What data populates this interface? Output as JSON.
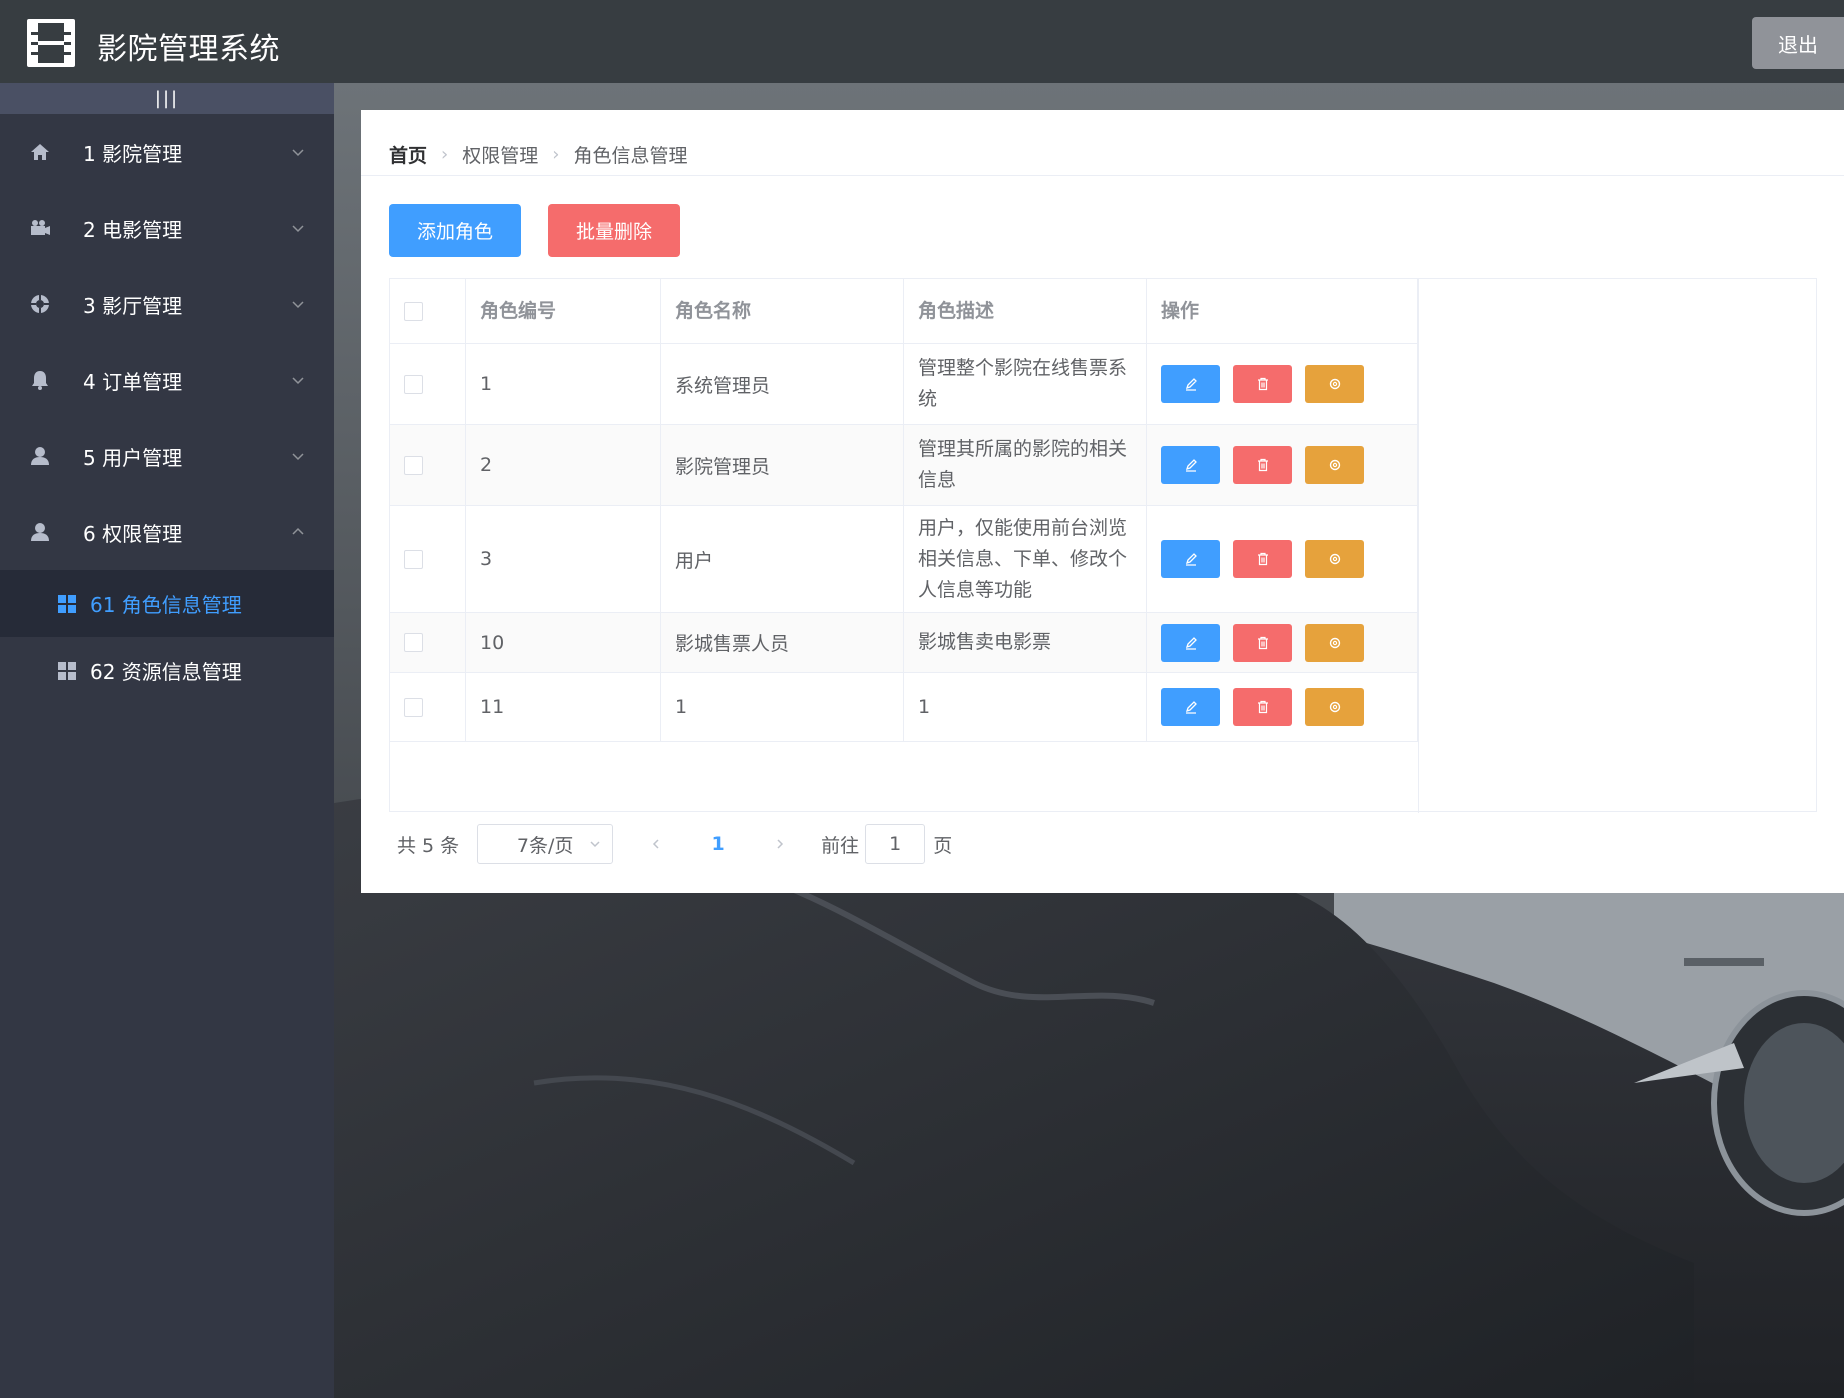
{
  "app": {
    "title": "影院管理系统",
    "logout_label": "退出"
  },
  "sidebar": {
    "collapse_label": "|||",
    "items": [
      {
        "label": "1 影院管理",
        "icon": "home-icon",
        "expanded": false
      },
      {
        "label": "2 电影管理",
        "icon": "camera-icon",
        "expanded": false
      },
      {
        "label": "3 影厅管理",
        "icon": "lifebuoy-icon",
        "expanded": false
      },
      {
        "label": "4 订单管理",
        "icon": "bell-icon",
        "expanded": false
      },
      {
        "label": "5 用户管理",
        "icon": "user-icon",
        "expanded": false
      },
      {
        "label": "6 权限管理",
        "icon": "user-icon",
        "expanded": true
      }
    ],
    "subitems": [
      {
        "label": "61 角色信息管理",
        "icon": "grid-icon",
        "active": true
      },
      {
        "label": "62 资源信息管理",
        "icon": "grid-icon",
        "active": false
      }
    ]
  },
  "breadcrumb": [
    "首页",
    "权限管理",
    "角色信息管理"
  ],
  "toolbar": {
    "add_label": "添加角色",
    "batch_delete_label": "批量删除"
  },
  "table": {
    "headers": [
      "角色编号",
      "角色名称",
      "角色描述",
      "操作"
    ],
    "rows": [
      {
        "id": "1",
        "name": "系统管理员",
        "desc": "管理整个影院在线售票系统"
      },
      {
        "id": "2",
        "name": "影院管理员",
        "desc": "管理其所属的影院的相关信息"
      },
      {
        "id": "3",
        "name": "用户",
        "desc": "用户，仅能使用前台浏览相关信息、下单、修改个人信息等功能"
      },
      {
        "id": "10",
        "name": "影城售票人员",
        "desc": "影城售卖电影票"
      },
      {
        "id": "11",
        "name": "1",
        "desc": "1"
      }
    ]
  },
  "pagination": {
    "total_label": "共 5 条",
    "page_size_label": "7条/页",
    "current_page": "1",
    "goto_label": "前往",
    "goto_value": "1",
    "page_suffix": "页"
  },
  "colors": {
    "primary": "#409eff",
    "danger": "#f56c6c",
    "warning": "#e6a23c",
    "sidebar": "#333744",
    "header": "#373d41"
  }
}
